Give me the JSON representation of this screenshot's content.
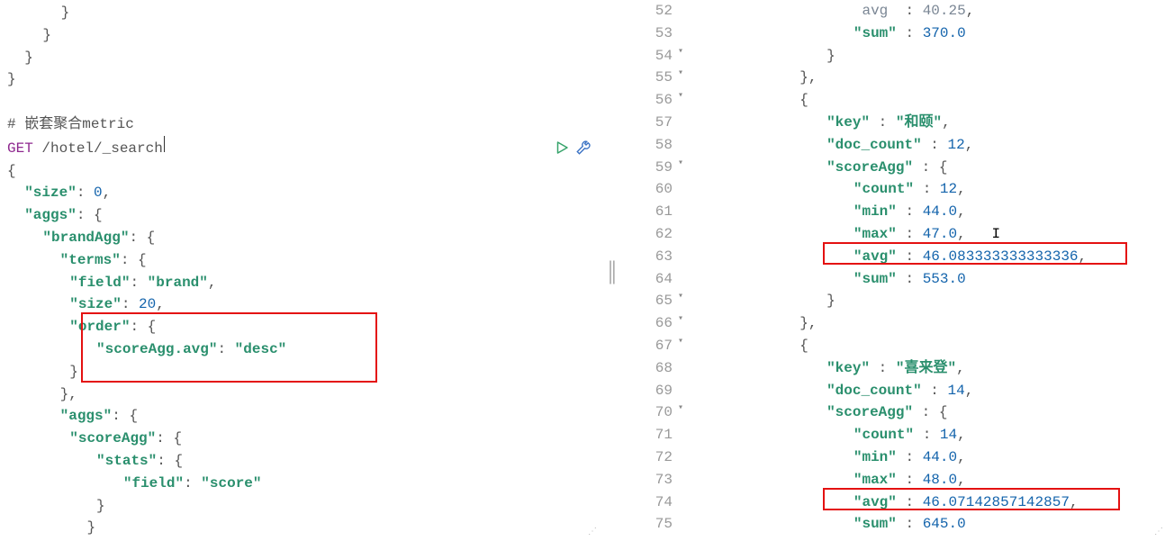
{
  "left": {
    "comment_prefix": "#",
    "comment_text": " 嵌套聚合metric",
    "method": "GET",
    "path": " /hotel/_search",
    "size_key": "\"size\"",
    "size_val": "0",
    "aggs_key": "\"aggs\"",
    "brandAgg_key": "\"brandAgg\"",
    "terms_key": "\"terms\"",
    "field_key": "\"field\"",
    "field_val_brand": "\"brand\"",
    "innerSize_key": "\"size\"",
    "innerSize_val": "20",
    "order_key": "\"order\"",
    "orderField_key": "\"scoreAgg.avg\"",
    "orderDir": "\"desc\"",
    "scoreAgg_key": "\"scoreAgg\"",
    "stats_key": "\"stats\"",
    "field_val_score": "\"score\""
  },
  "right": {
    "lines": [
      {
        "n": "52",
        "i": 6,
        "tokens": [
          {
            "t": " avg",
            "c": "txt-dim"
          },
          {
            "t": "  : ",
            "c": "punc"
          },
          {
            "t": "40.25",
            "c": "txt-dim"
          },
          {
            "t": ",",
            "c": "punc"
          }
        ]
      },
      {
        "n": "53",
        "i": 6,
        "tokens": [
          {
            "t": "\"sum\"",
            "c": "str"
          },
          {
            "t": " : ",
            "c": "punc"
          },
          {
            "t": "370.0",
            "c": "num"
          }
        ]
      },
      {
        "n": "54",
        "i": 5,
        "exp": true,
        "tokens": [
          {
            "t": "}",
            "c": "punc"
          }
        ]
      },
      {
        "n": "55",
        "i": 4,
        "exp": true,
        "tokens": [
          {
            "t": "},",
            "c": "punc"
          }
        ]
      },
      {
        "n": "56",
        "i": 4,
        "exp": true,
        "tokens": [
          {
            "t": "{",
            "c": "punc"
          }
        ]
      },
      {
        "n": "57",
        "i": 5,
        "tokens": [
          {
            "t": "\"key\"",
            "c": "str"
          },
          {
            "t": " : ",
            "c": "punc"
          },
          {
            "t": "\"和颐\"",
            "c": "str"
          },
          {
            "t": ",",
            "c": "punc"
          }
        ]
      },
      {
        "n": "58",
        "i": 5,
        "tokens": [
          {
            "t": "\"doc_count\"",
            "c": "str"
          },
          {
            "t": " : ",
            "c": "punc"
          },
          {
            "t": "12",
            "c": "num"
          },
          {
            "t": ",",
            "c": "punc"
          }
        ]
      },
      {
        "n": "59",
        "i": 5,
        "exp": true,
        "tokens": [
          {
            "t": "\"scoreAgg\"",
            "c": "str"
          },
          {
            "t": " : {",
            "c": "punc"
          }
        ]
      },
      {
        "n": "60",
        "i": 6,
        "tokens": [
          {
            "t": "\"count\"",
            "c": "str"
          },
          {
            "t": " : ",
            "c": "punc"
          },
          {
            "t": "12",
            "c": "num"
          },
          {
            "t": ",",
            "c": "punc"
          }
        ]
      },
      {
        "n": "61",
        "i": 6,
        "tokens": [
          {
            "t": "\"min\"",
            "c": "str"
          },
          {
            "t": " : ",
            "c": "punc"
          },
          {
            "t": "44.0",
            "c": "num"
          },
          {
            "t": ",",
            "c": "punc"
          }
        ]
      },
      {
        "n": "62",
        "i": 6,
        "tokens": [
          {
            "t": "\"max\"",
            "c": "str"
          },
          {
            "t": " : ",
            "c": "punc"
          },
          {
            "t": "47.0",
            "c": "num"
          },
          {
            "t": ",   ",
            "c": "punc"
          },
          {
            "t": "I",
            "c": "cursor-i"
          }
        ]
      },
      {
        "n": "63",
        "i": 6,
        "tokens": [
          {
            "t": "\"avg\"",
            "c": "str"
          },
          {
            "t": " : ",
            "c": "punc"
          },
          {
            "t": "46.083333333333336",
            "c": "num"
          },
          {
            "t": ",",
            "c": "punc"
          }
        ]
      },
      {
        "n": "64",
        "i": 6,
        "tokens": [
          {
            "t": "\"sum\"",
            "c": "str"
          },
          {
            "t": " : ",
            "c": "punc"
          },
          {
            "t": "553.0",
            "c": "num"
          }
        ]
      },
      {
        "n": "65",
        "i": 5,
        "exp": true,
        "tokens": [
          {
            "t": "}",
            "c": "punc"
          }
        ]
      },
      {
        "n": "66",
        "i": 4,
        "exp": true,
        "tokens": [
          {
            "t": "},",
            "c": "punc"
          }
        ]
      },
      {
        "n": "67",
        "i": 4,
        "exp": true,
        "tokens": [
          {
            "t": "{",
            "c": "punc"
          }
        ]
      },
      {
        "n": "68",
        "i": 5,
        "tokens": [
          {
            "t": "\"key\"",
            "c": "str"
          },
          {
            "t": " : ",
            "c": "punc"
          },
          {
            "t": "\"喜来登\"",
            "c": "str"
          },
          {
            "t": ",",
            "c": "punc"
          }
        ]
      },
      {
        "n": "69",
        "i": 5,
        "tokens": [
          {
            "t": "\"doc_count\"",
            "c": "str"
          },
          {
            "t": " : ",
            "c": "punc"
          },
          {
            "t": "14",
            "c": "num"
          },
          {
            "t": ",",
            "c": "punc"
          }
        ]
      },
      {
        "n": "70",
        "i": 5,
        "exp": true,
        "tokens": [
          {
            "t": "\"scoreAgg\"",
            "c": "str"
          },
          {
            "t": " : {",
            "c": "punc"
          }
        ]
      },
      {
        "n": "71",
        "i": 6,
        "tokens": [
          {
            "t": "\"count\"",
            "c": "str"
          },
          {
            "t": " : ",
            "c": "punc"
          },
          {
            "t": "14",
            "c": "num"
          },
          {
            "t": ",",
            "c": "punc"
          }
        ]
      },
      {
        "n": "72",
        "i": 6,
        "tokens": [
          {
            "t": "\"min\"",
            "c": "str"
          },
          {
            "t": " : ",
            "c": "punc"
          },
          {
            "t": "44.0",
            "c": "num"
          },
          {
            "t": ",",
            "c": "punc"
          }
        ]
      },
      {
        "n": "73",
        "i": 6,
        "tokens": [
          {
            "t": "\"max\"",
            "c": "str"
          },
          {
            "t": " : ",
            "c": "punc"
          },
          {
            "t": "48.0",
            "c": "num"
          },
          {
            "t": ",",
            "c": "punc"
          }
        ]
      },
      {
        "n": "74",
        "i": 6,
        "tokens": [
          {
            "t": "\"avg\"",
            "c": "str"
          },
          {
            "t": " : ",
            "c": "punc"
          },
          {
            "t": "46.07142857142857",
            "c": "num"
          },
          {
            "t": ",",
            "c": "punc"
          }
        ]
      },
      {
        "n": "75",
        "i": 6,
        "tokens": [
          {
            "t": "\"sum\"",
            "c": "str"
          },
          {
            "t": " : ",
            "c": "punc"
          },
          {
            "t": "645.0",
            "c": "num"
          }
        ]
      }
    ]
  }
}
